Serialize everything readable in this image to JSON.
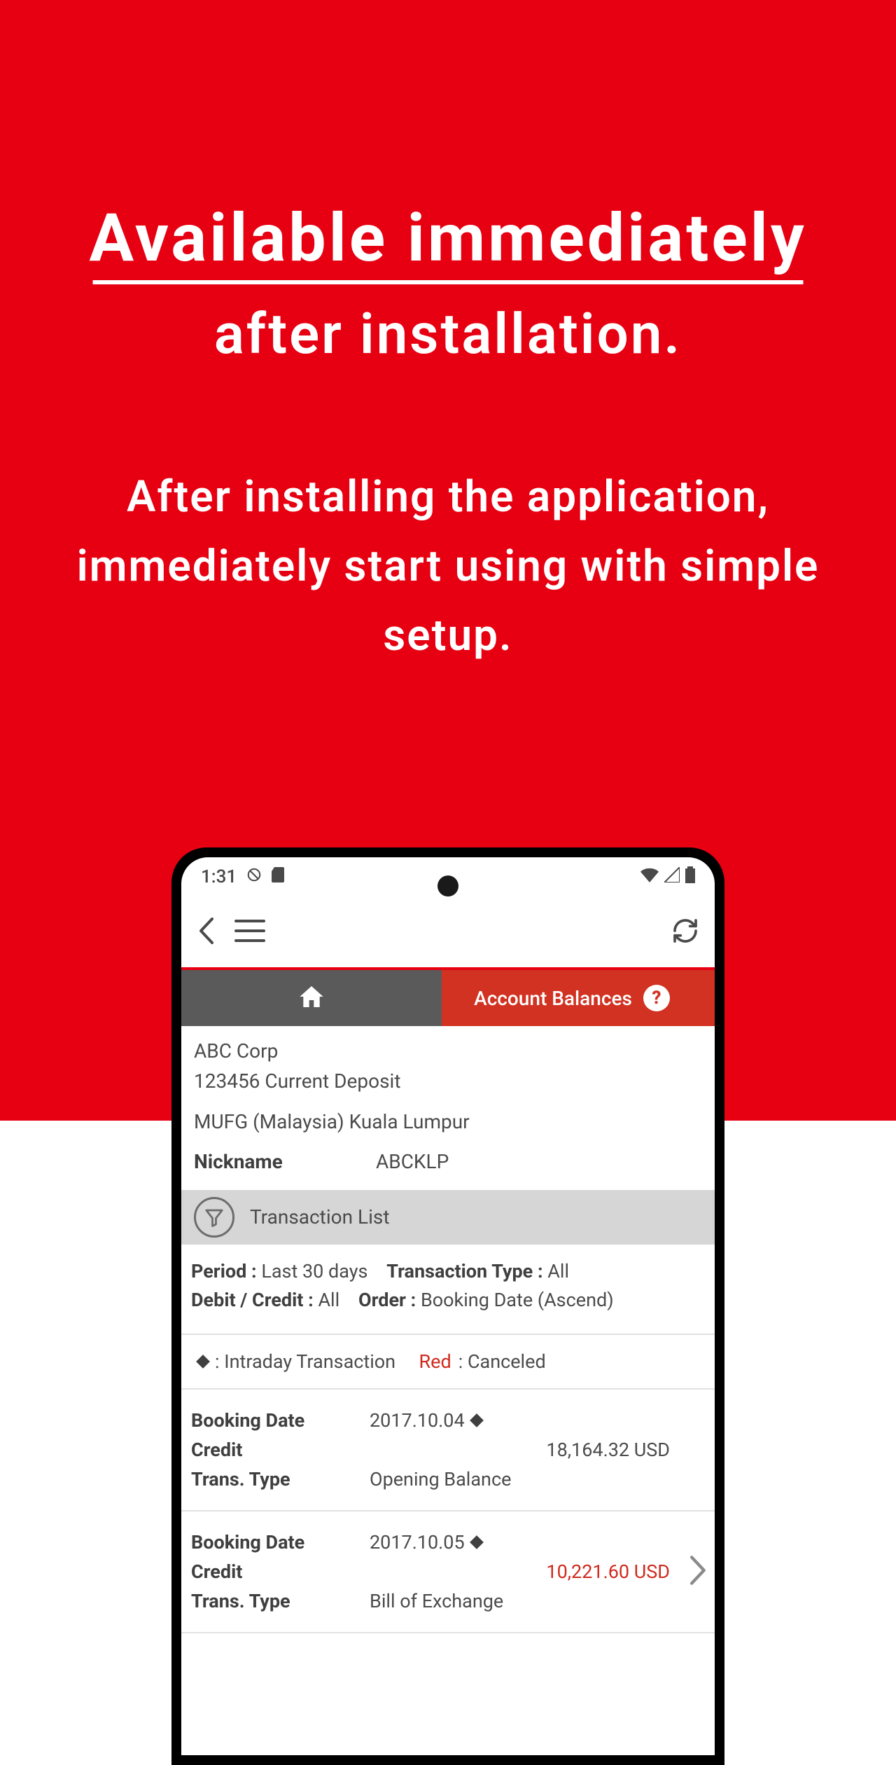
{
  "marketing": {
    "headline1": "Available immediately",
    "headline2": "after installation.",
    "body": "After installing the application, immediately start using with simple setup."
  },
  "status": {
    "time": "1:31"
  },
  "tabs": {
    "balances_label": "Account Balances"
  },
  "account": {
    "name": "ABC Corp",
    "number_type": "123456 Current Deposit",
    "bank": "MUFG (Malaysia) Kuala Lumpur",
    "nickname_label": "Nickname",
    "nickname_value": "ABCKLP"
  },
  "txn_header": "Transaction List",
  "meta": {
    "period_label": "Period :",
    "period_value": "Last 30 days",
    "txtype_label": "Transaction Type :",
    "txtype_value": "All",
    "dc_label": "Debit / Credit :",
    "dc_value": "All",
    "order_label": "Order :",
    "order_value": "Booking Date (Ascend)"
  },
  "legend": {
    "diamond_label": ": Intraday Transaction",
    "red_label": "Red",
    "red_desc": ": Canceled"
  },
  "labels": {
    "booking": "Booking Date",
    "credit": "Credit",
    "type": "Trans. Type"
  },
  "txns": [
    {
      "date": "2017.10.04",
      "amount": "18,164.32 USD",
      "type": "Opening Balance",
      "canceled": false
    },
    {
      "date": "2017.10.05",
      "amount": "10,221.60 USD",
      "type": "Bill of Exchange",
      "canceled": true
    }
  ]
}
